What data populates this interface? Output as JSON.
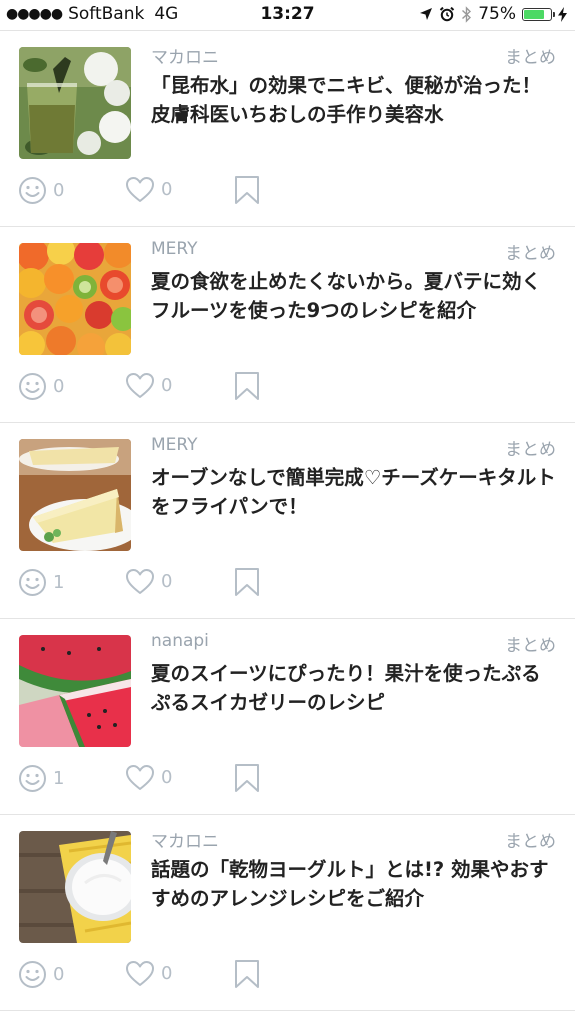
{
  "status_bar": {
    "signal": "●●●●●",
    "carrier": "SoftBank",
    "network": "4G",
    "time": "13:27",
    "battery": "75%",
    "battery_level": 0.75,
    "icons": [
      "location-arrow-icon",
      "alarm-icon",
      "bluetooth-icon",
      "battery-icon",
      "charging-bolt-icon"
    ]
  },
  "articles": [
    {
      "source": "マカロニ",
      "category": "まとめ",
      "title": "「昆布水」の効果でニキビ、便秘が治った！皮膚科医いちおしの手作り美容水",
      "reactions": "0",
      "likes": "0",
      "thumb": "kelp-water-glass-flowers"
    },
    {
      "source": "MERY",
      "category": "まとめ",
      "title": "夏の食欲を止めたくないから。夏バテに効くフルーツを使った9つのレシピを紹介",
      "reactions": "0",
      "likes": "0",
      "thumb": "citrus-fruits-kiwi"
    },
    {
      "source": "MERY",
      "category": "まとめ",
      "title": "オーブンなしで簡単完成♡チーズケーキタルトをフライパンで！",
      "reactions": "1",
      "likes": "0",
      "thumb": "cheesecake-tart-slice"
    },
    {
      "source": "nanapi",
      "category": "まとめ",
      "title": "夏のスイーツにぴったり！果汁を使ったぷるぷるスイカゼリーのレシピ",
      "reactions": "1",
      "likes": "0",
      "thumb": "watermelon-jelly"
    },
    {
      "source": "マカロニ",
      "category": "まとめ",
      "title": "話題の「乾物ヨーグルト」とは!? 効果やおすすめのアレンジレシピをご紹介",
      "reactions": "0",
      "likes": "0",
      "thumb": "yogurt-bowl-spoon"
    }
  ],
  "colors": {
    "meta_text": "#9aa4ae",
    "action_icon": "#b5bec7",
    "battery_fill": "#4cd964"
  }
}
